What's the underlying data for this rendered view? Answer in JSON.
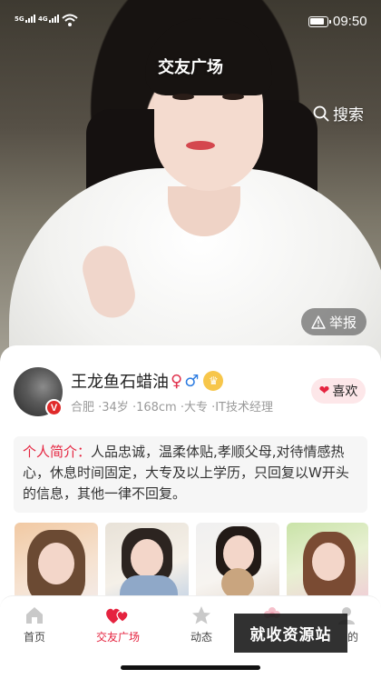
{
  "status_bar": {
    "sim1": "5G",
    "sim2": "4G",
    "time": "09:50"
  },
  "header": {
    "title": "交友广场",
    "search_label": "搜索",
    "report_label": "举报"
  },
  "profile": {
    "name": "王龙鱼石蜡油",
    "female_symbol": "♀",
    "male_symbol": "♂",
    "vip_badge": "V",
    "info": "合肥 ·34岁 ·168cm ·大专 ·IT技术经理",
    "like_label": "喜欢",
    "intro_label": "个人简介：",
    "intro_text": "人品忠诚，温柔体贴,孝顺父母,对待情感热心，休息时间固定，大专及以上学历，只回复以W开头的信息，其他一律不回复。"
  },
  "tabs": [
    {
      "label": "首页",
      "icon": "home-icon"
    },
    {
      "label": "交友广场",
      "icon": "hearts-icon"
    },
    {
      "label": "动态",
      "icon": "star-icon"
    },
    {
      "label": "",
      "icon": "flower-icon"
    },
    {
      "label": "的",
      "icon": "person-icon"
    }
  ],
  "watermark": "就收资源站",
  "colors": {
    "accent": "#e5233f",
    "like_bg": "#fde7e9",
    "male": "#2f7de1",
    "crown": "#f7c64a"
  }
}
